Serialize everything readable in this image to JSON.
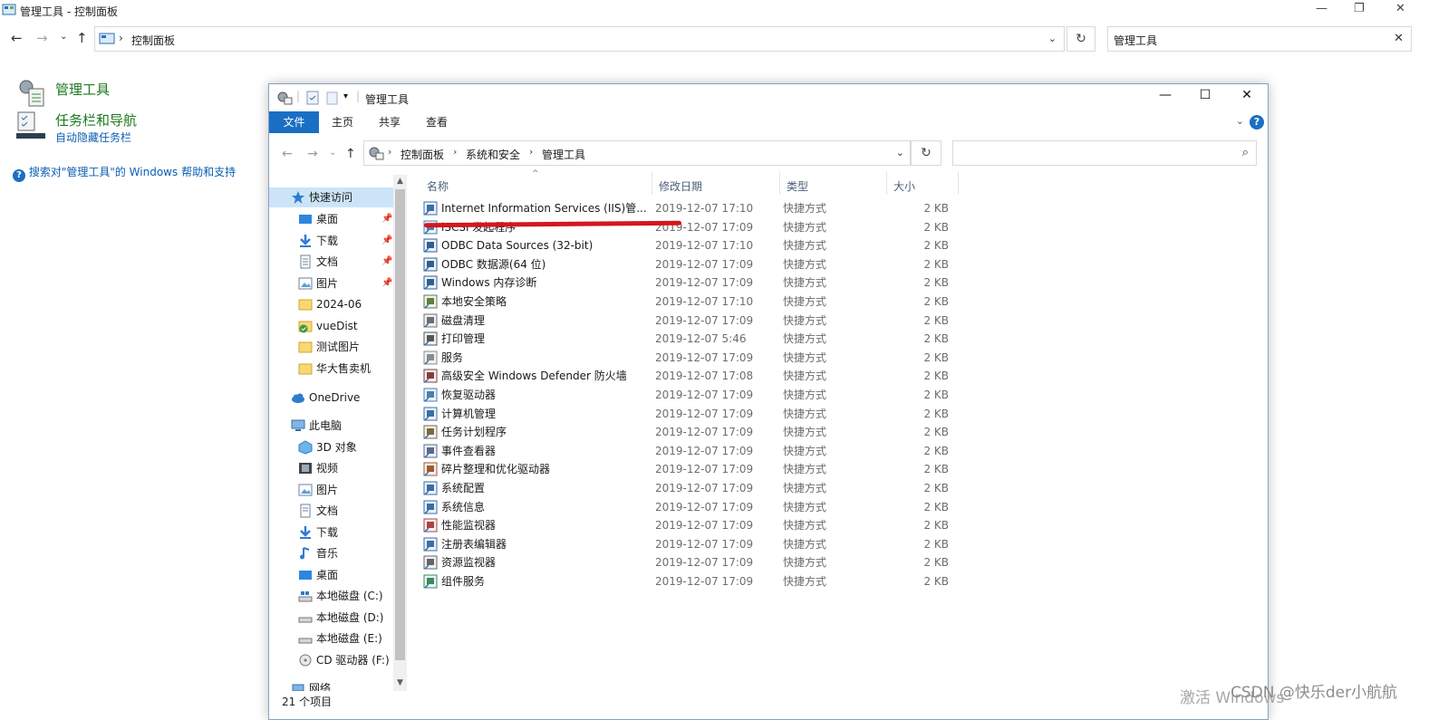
{
  "bg_window": {
    "title": "管理工具 - 控制面板",
    "address": "控制面板",
    "search_value": "管理工具",
    "results": [
      {
        "title": "管理工具",
        "sub": ""
      },
      {
        "title": "任务栏和导航",
        "sub": "自动隐藏任务栏"
      }
    ],
    "help_link": "搜索对\"管理工具\"的 Windows 帮助和支持"
  },
  "window": {
    "title": "管理工具",
    "ribbon_tabs": [
      "文件",
      "主页",
      "共享",
      "查看"
    ],
    "breadcrumbs": [
      "控制面板",
      "系统和安全",
      "管理工具"
    ],
    "search_placeholder": ""
  },
  "nav": {
    "quick_access": "快速访问",
    "quick_items": [
      {
        "label": "桌面",
        "icon": "desktop-icon",
        "pinned": true
      },
      {
        "label": "下载",
        "icon": "download-icon",
        "pinned": true
      },
      {
        "label": "文档",
        "icon": "document-icon",
        "pinned": true
      },
      {
        "label": "图片",
        "icon": "pictures-icon",
        "pinned": true
      },
      {
        "label": "2024-06",
        "icon": "folder-icon",
        "pinned": false
      },
      {
        "label": "vueDist",
        "icon": "folder-synced-icon",
        "pinned": false
      },
      {
        "label": "测试图片",
        "icon": "folder-icon",
        "pinned": false
      },
      {
        "label": "华大售卖机",
        "icon": "folder-icon",
        "pinned": false
      }
    ],
    "onedrive": "OneDrive",
    "this_pc": "此电脑",
    "pc_items": [
      {
        "label": "3D 对象",
        "icon": "3d-objects-icon"
      },
      {
        "label": "视频",
        "icon": "video-icon"
      },
      {
        "label": "图片",
        "icon": "pictures-icon"
      },
      {
        "label": "文档",
        "icon": "document-icon"
      },
      {
        "label": "下载",
        "icon": "download-icon"
      },
      {
        "label": "音乐",
        "icon": "music-icon"
      },
      {
        "label": "桌面",
        "icon": "desktop-icon"
      },
      {
        "label": "本地磁盘 (C:)",
        "icon": "drive-c-icon"
      },
      {
        "label": "本地磁盘 (D:)",
        "icon": "drive-icon"
      },
      {
        "label": "本地磁盘 (E:)",
        "icon": "drive-icon"
      },
      {
        "label": "CD 驱动器 (F:)",
        "icon": "cd-drive-icon"
      }
    ],
    "network": "网络"
  },
  "columns": [
    "名称",
    "修改日期",
    "类型",
    "大小"
  ],
  "files": [
    {
      "name": "Internet Information Services (IIS)管...",
      "date": "2019-12-07 17:10",
      "type": "快捷方式",
      "size": "2 KB"
    },
    {
      "name": "iSCSI 发起程序",
      "date": "2019-12-07 17:09",
      "type": "快捷方式",
      "size": "2 KB"
    },
    {
      "name": "ODBC Data Sources (32-bit)",
      "date": "2019-12-07 17:10",
      "type": "快捷方式",
      "size": "2 KB"
    },
    {
      "name": "ODBC 数据源(64 位)",
      "date": "2019-12-07 17:09",
      "type": "快捷方式",
      "size": "2 KB"
    },
    {
      "name": "Windows 内存诊断",
      "date": "2019-12-07 17:09",
      "type": "快捷方式",
      "size": "2 KB"
    },
    {
      "name": "本地安全策略",
      "date": "2019-12-07 17:10",
      "type": "快捷方式",
      "size": "2 KB"
    },
    {
      "name": "磁盘清理",
      "date": "2019-12-07 17:09",
      "type": "快捷方式",
      "size": "2 KB"
    },
    {
      "name": "打印管理",
      "date": "2019-12-07 5:46",
      "type": "快捷方式",
      "size": "2 KB"
    },
    {
      "name": "服务",
      "date": "2019-12-07 17:09",
      "type": "快捷方式",
      "size": "2 KB"
    },
    {
      "name": "高级安全 Windows Defender 防火墙",
      "date": "2019-12-07 17:08",
      "type": "快捷方式",
      "size": "2 KB"
    },
    {
      "name": "恢复驱动器",
      "date": "2019-12-07 17:09",
      "type": "快捷方式",
      "size": "2 KB"
    },
    {
      "name": "计算机管理",
      "date": "2019-12-07 17:09",
      "type": "快捷方式",
      "size": "2 KB"
    },
    {
      "name": "任务计划程序",
      "date": "2019-12-07 17:09",
      "type": "快捷方式",
      "size": "2 KB"
    },
    {
      "name": "事件查看器",
      "date": "2019-12-07 17:09",
      "type": "快捷方式",
      "size": "2 KB"
    },
    {
      "name": "碎片整理和优化驱动器",
      "date": "2019-12-07 17:09",
      "type": "快捷方式",
      "size": "2 KB"
    },
    {
      "name": "系统配置",
      "date": "2019-12-07 17:09",
      "type": "快捷方式",
      "size": "2 KB"
    },
    {
      "name": "系统信息",
      "date": "2019-12-07 17:09",
      "type": "快捷方式",
      "size": "2 KB"
    },
    {
      "name": "性能监视器",
      "date": "2019-12-07 17:09",
      "type": "快捷方式",
      "size": "2 KB"
    },
    {
      "name": "注册表编辑器",
      "date": "2019-12-07 17:09",
      "type": "快捷方式",
      "size": "2 KB"
    },
    {
      "name": "资源监视器",
      "date": "2019-12-07 17:09",
      "type": "快捷方式",
      "size": "2 KB"
    },
    {
      "name": "组件服务",
      "date": "2019-12-07 17:09",
      "type": "快捷方式",
      "size": "2 KB"
    }
  ],
  "status": "21 个项目",
  "watermark": "激活 Windows",
  "csdn": "CSDN @快乐der小航航",
  "colors": {
    "accent": "#1a6fc4",
    "link_green": "#1e7a1e",
    "link_blue": "#0a5fb3",
    "annotation_red": "#d4161f"
  }
}
